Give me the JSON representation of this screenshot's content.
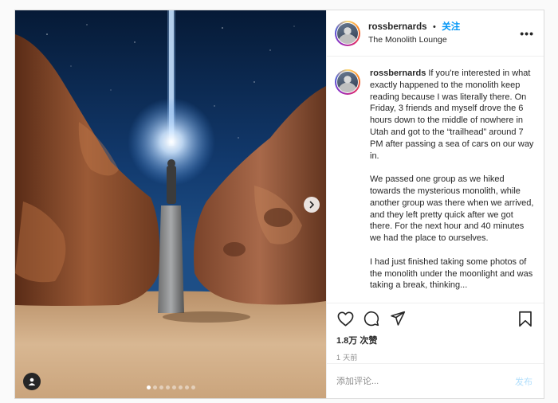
{
  "post": {
    "username": "rossbernards",
    "follow_label": "关注",
    "separator": "•",
    "location": "The Monolith Lounge",
    "more_label": "•••",
    "caption_username": "rossbernards",
    "caption_paragraphs": [
      "If you're interested in what exactly happened to the monolith keep reading because I was literally there. On Friday, 3 friends and myself drove the 6 hours down to the middle of nowhere in Utah and got to the “trailhead” around 7 PM after passing a sea of cars on our way in.",
      "We passed one group as we hiked towards the mysterious monolith, while another group was there when we arrived, and they left pretty quick after we got there. For the next hour and 40 minutes we had the place to ourselves.",
      "I had just finished taking some photos of the monolith under the moonlight and was taking a break, thinking..."
    ],
    "likes": "1.8万 次赞",
    "time": "1 天前",
    "comment_placeholder": "添加评论...",
    "post_label": "发布",
    "carousel": {
      "count": 8,
      "active_index": 0
    }
  },
  "icons": {
    "like": "heart-icon",
    "comment": "comment-icon",
    "share": "send-icon",
    "save": "bookmark-icon",
    "next": "chevron-right-icon",
    "user_tags": "user-icon",
    "more": "more-options-icon"
  },
  "colors": {
    "accent": "#0095f6",
    "post_disabled": "#b2dffc",
    "text": "#262626",
    "muted": "#8e8e8e"
  }
}
